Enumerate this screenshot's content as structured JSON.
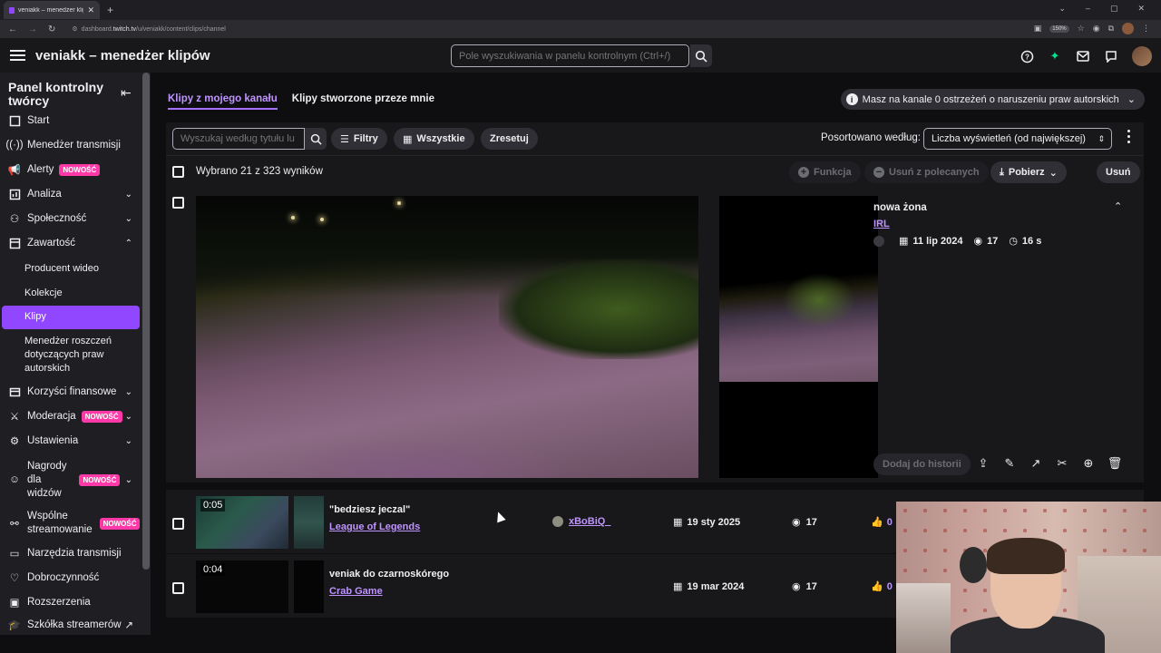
{
  "browser": {
    "tab_title": "veniakk – menedżer klipów",
    "url_prefix": "dashboard.",
    "url_domain": "twitch.tv",
    "url_path": "/u/veniakk/content/clips/channel",
    "zoom": "150%"
  },
  "topnav": {
    "title": "veniakk – menedżer klipów",
    "search_placeholder": "Pole wyszukiwania w panelu kontrolnym (Ctrl+/)"
  },
  "sidebar": {
    "heading": "Panel kontrolny twórcy",
    "items": [
      {
        "label": "Start"
      },
      {
        "label": "Menedżer transmisji"
      },
      {
        "label": "Alerty",
        "badge": "NOWOŚĆ"
      },
      {
        "label": "Analiza"
      },
      {
        "label": "Społeczność"
      },
      {
        "label": "Zawartość"
      },
      {
        "label": "Korzyści finansowe"
      },
      {
        "label": "Moderacja",
        "badge": "NOWOŚĆ"
      },
      {
        "label": "Ustawienia"
      },
      {
        "label": "Nagrody dla widzów",
        "badge": "NOWOŚĆ"
      },
      {
        "label": "Wspólne streamowanie",
        "badge": "NOWOŚĆ"
      },
      {
        "label": "Narzędzia transmisji"
      },
      {
        "label": "Dobroczynność"
      },
      {
        "label": "Rozszerzenia"
      },
      {
        "label": "Szkółka streamerów"
      }
    ],
    "subitems": {
      "producer": "Producent wideo",
      "collections": "Kolekcje",
      "clips": "Klipy",
      "claims": "Menedżer roszczeń dotyczących praw autorskich"
    },
    "nagrody_lines": [
      "Nagrody",
      "dla",
      "widzów"
    ],
    "wspolne_lines": [
      "Wspólne",
      "streamowanie"
    ]
  },
  "main": {
    "tabs": [
      "Klipy z mojego kanału",
      "Klipy stworzone przeze mnie"
    ],
    "warning": "Masz na kanale 0 ostrzeżeń o naruszeniu praw autorskich",
    "search_placeholder": "Wyszukaj według tytułu lu",
    "filters_label": "Filtry",
    "all_label": "Wszystkie",
    "reset_label": "Zresetuj",
    "sort_label": "Posortowano według:",
    "sort_value": "Liczba wyświetleń (od największej)",
    "selection_text": "Wybrano 21 z 323 wyników",
    "actions": {
      "feature": "Funkcja",
      "unfeature": "Usuń z polecanych",
      "download": "Pobierz",
      "delete": "Usuń"
    }
  },
  "expanded_clip": {
    "title": "nowa żona",
    "category": "IRL",
    "date": "11 lip 2024",
    "views": "17",
    "duration": "16 s",
    "history_button": "Dodaj do historii"
  },
  "clips": [
    {
      "duration": "0:05",
      "title": "\"bedziesz jeczal\"",
      "category": "League of Legends",
      "creator": "xBoBiQ_",
      "date": "19 sty 2025",
      "views": "17",
      "likes": "0"
    },
    {
      "duration": "0:04",
      "title": "veniak do czarnoskórego",
      "category": "Crab Game",
      "creator": "",
      "date": "19 mar 2024",
      "views": "17",
      "likes": "0"
    }
  ],
  "colors": {
    "accent": "#9147ff",
    "link": "#bf94ff",
    "badge": "#ff3aa8"
  }
}
